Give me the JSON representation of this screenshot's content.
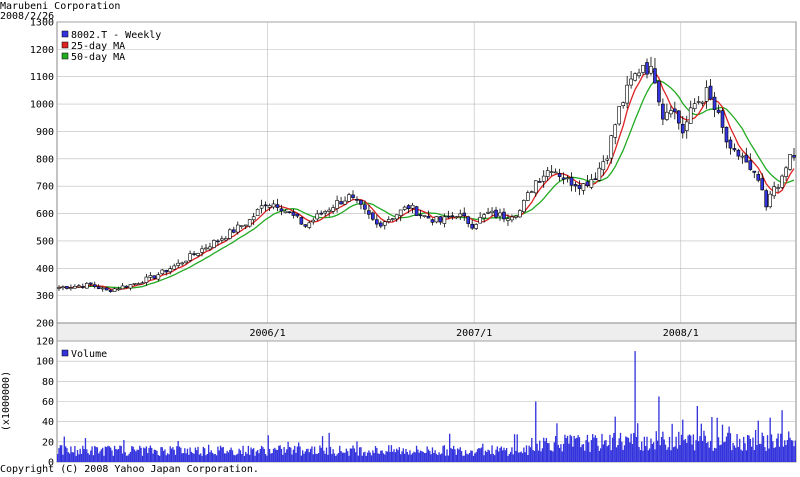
{
  "header": {
    "company": "Marubeni  Corporation",
    "date": "2008/2/26"
  },
  "footer": {
    "copyright": "Copyright (C) 2008 Yahoo Japan Corporation."
  },
  "colors": {
    "candle_up": "#ffffff",
    "candle_down": "#3333dd",
    "ma25": "#dd2222",
    "ma50": "#22aa22",
    "volume": "#3333dd",
    "grid": "#bbbbbb",
    "axis_band": "#eeeeee"
  },
  "chart_data": [
    {
      "type": "candlestick",
      "legend": [
        "8002.T - Weekly",
        "25-day MA",
        "50-day MA"
      ],
      "legend_position": "top-left",
      "ylim": [
        200,
        1300
      ],
      "yticks": [
        200,
        300,
        400,
        500,
        600,
        700,
        800,
        900,
        1000,
        1100,
        1200,
        1300
      ],
      "xlabels": [
        "2006/1",
        "2007/1",
        "2008/1"
      ],
      "grid": true,
      "anchors_close": [
        [
          0,
          330
        ],
        [
          8,
          340
        ],
        [
          12,
          318
        ],
        [
          18,
          340
        ],
        [
          24,
          370
        ],
        [
          30,
          415
        ],
        [
          36,
          470
        ],
        [
          42,
          520
        ],
        [
          48,
          575
        ],
        [
          52,
          640
        ],
        [
          55,
          635
        ],
        [
          58,
          600
        ],
        [
          62,
          555
        ],
        [
          66,
          600
        ],
        [
          70,
          640
        ],
        [
          73,
          660
        ],
        [
          76,
          620
        ],
        [
          80,
          560
        ],
        [
          84,
          590
        ],
        [
          88,
          625
        ],
        [
          92,
          590
        ],
        [
          96,
          570
        ],
        [
          100,
          600
        ],
        [
          104,
          560
        ],
        [
          108,
          600
        ],
        [
          112,
          590
        ],
        [
          116,
          610
        ],
        [
          120,
          720
        ],
        [
          124,
          770
        ],
        [
          128,
          720
        ],
        [
          132,
          705
        ],
        [
          135,
          740
        ],
        [
          138,
          820
        ],
        [
          141,
          980
        ],
        [
          144,
          1080
        ],
        [
          147,
          1150
        ],
        [
          150,
          1100
        ],
        [
          152,
          960
        ],
        [
          154,
          1000
        ],
        [
          157,
          900
        ],
        [
          160,
          1000
        ],
        [
          163,
          1040
        ],
        [
          166,
          950
        ],
        [
          169,
          820
        ],
        [
          172,
          810
        ],
        [
          174,
          750
        ],
        [
          176,
          720
        ],
        [
          178,
          620
        ],
        [
          180,
          700
        ],
        [
          182,
          720
        ],
        [
          184,
          810
        ]
      ]
    },
    {
      "type": "bar",
      "title": "Volume",
      "ylabel": "(x1000000)",
      "ylim": [
        0,
        120
      ],
      "yticks": [
        0,
        20,
        40,
        60,
        80,
        100,
        120
      ],
      "grid": true,
      "peaks": [
        [
          120,
          60
        ],
        [
          140,
          45
        ],
        [
          145,
          110
        ],
        [
          151,
          65
        ],
        [
          157,
          42
        ],
        [
          176,
          41
        ],
        [
          179,
          44
        ]
      ]
    }
  ]
}
